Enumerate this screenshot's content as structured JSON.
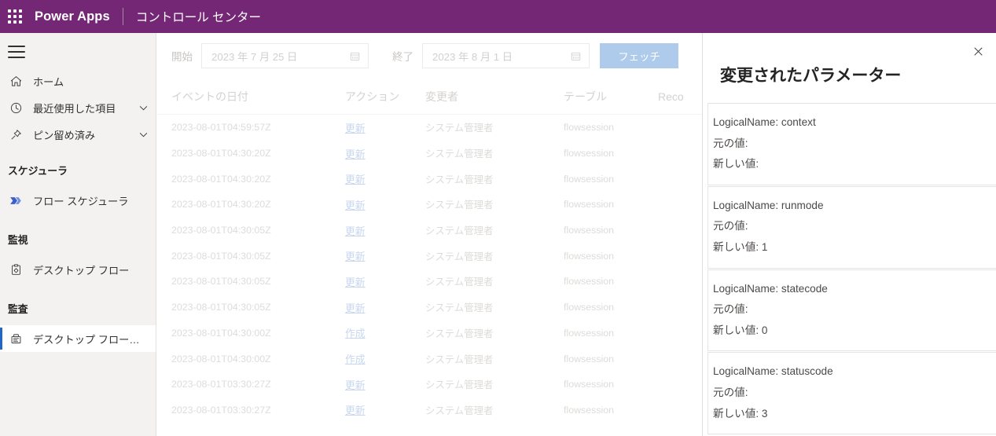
{
  "topbar": {
    "waffle_icon": "app-launcher-icon",
    "brand": "Power Apps",
    "app_title": "コントロール センター"
  },
  "sidebar": {
    "menu_icon": "hamburger-icon",
    "items": [
      {
        "label": "ホーム",
        "icon": "home-icon",
        "chevron": false,
        "selected": false
      },
      {
        "label": "最近使用した項目",
        "icon": "clock-icon",
        "chevron": true,
        "selected": false
      },
      {
        "label": "ピン留め済み",
        "icon": "pin-icon",
        "chevron": true,
        "selected": false
      }
    ],
    "sections": [
      {
        "heading": "スケジューラ",
        "items": [
          {
            "label": "フロー スケジューラ",
            "icon": "flow-icon",
            "selected": false
          }
        ]
      },
      {
        "heading": "監視",
        "items": [
          {
            "label": "デスクトップ フロー",
            "icon": "clipboard-gear-icon",
            "selected": false
          }
        ]
      },
      {
        "heading": "監査",
        "items": [
          {
            "label": "デスクトップ フローのログ",
            "icon": "clipboard-log-icon",
            "selected": true
          }
        ]
      }
    ]
  },
  "toolbar": {
    "start_label": "開始",
    "start_date": "2023 年 7 月 25 日",
    "end_label": "終了",
    "end_date": "2023 年 8 月 1 日",
    "calendar_icon": "calendar-icon",
    "fetch_label": "フェッチ",
    "fetch_color": "#afcbeb"
  },
  "table": {
    "columns": [
      {
        "key": "date",
        "label": "イベントの日付"
      },
      {
        "key": "action",
        "label": "アクション"
      },
      {
        "key": "user",
        "label": "変更者"
      },
      {
        "key": "table",
        "label": "テーブル"
      },
      {
        "key": "record",
        "label": "Reco"
      }
    ],
    "rows": [
      {
        "date": "2023-08-01T04:59:57Z",
        "action": "更新",
        "user": "システム管理者",
        "table": "flowsession",
        "record": ""
      },
      {
        "date": "2023-08-01T04:30:20Z",
        "action": "更新",
        "user": "システム管理者",
        "table": "flowsession",
        "record": ""
      },
      {
        "date": "2023-08-01T04:30:20Z",
        "action": "更新",
        "user": "システム管理者",
        "table": "flowsession",
        "record": ""
      },
      {
        "date": "2023-08-01T04:30:20Z",
        "action": "更新",
        "user": "システム管理者",
        "table": "flowsession",
        "record": ""
      },
      {
        "date": "2023-08-01T04:30:05Z",
        "action": "更新",
        "user": "システム管理者",
        "table": "flowsession",
        "record": ""
      },
      {
        "date": "2023-08-01T04:30:05Z",
        "action": "更新",
        "user": "システム管理者",
        "table": "flowsession",
        "record": ""
      },
      {
        "date": "2023-08-01T04:30:05Z",
        "action": "更新",
        "user": "システム管理者",
        "table": "flowsession",
        "record": ""
      },
      {
        "date": "2023-08-01T04:30:05Z",
        "action": "更新",
        "user": "システム管理者",
        "table": "flowsession",
        "record": ""
      },
      {
        "date": "2023-08-01T04:30:00Z",
        "action": "作成",
        "user": "システム管理者",
        "table": "flowsession",
        "record": ""
      },
      {
        "date": "2023-08-01T04:30:00Z",
        "action": "作成",
        "user": "システム管理者",
        "table": "flowsession",
        "record": ""
      },
      {
        "date": "2023-08-01T03:30:27Z",
        "action": "更新",
        "user": "システム管理者",
        "table": "flowsession",
        "record": ""
      },
      {
        "date": "2023-08-01T03:30:27Z",
        "action": "更新",
        "user": "システム管理者",
        "table": "flowsession",
        "record": ""
      }
    ]
  },
  "panel": {
    "title": "変更されたパラメーター",
    "close_icon": "close-icon",
    "cards": [
      {
        "name": "LogicalName: context",
        "old": "元の値:",
        "new": "新しい値:"
      },
      {
        "name": "LogicalName: runmode",
        "old": "元の値:",
        "new": "新しい値: 1"
      },
      {
        "name": "LogicalName: statecode",
        "old": "元の値:",
        "new": "新しい値: 0"
      },
      {
        "name": "LogicalName: statuscode",
        "old": "元の値:",
        "new": "新しい値: 3"
      }
    ]
  }
}
